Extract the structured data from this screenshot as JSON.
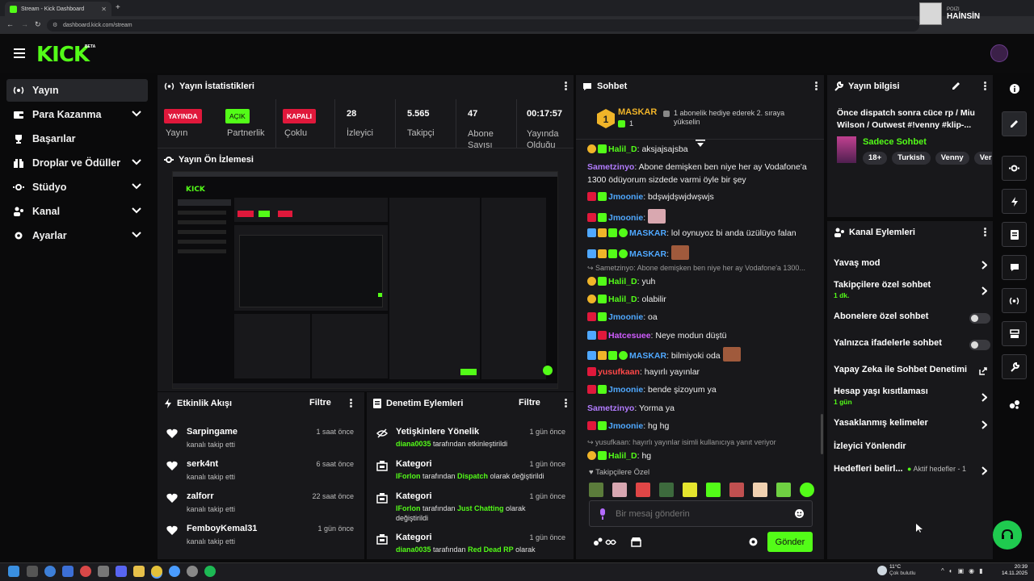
{
  "browser": {
    "tab_title": "Stream - Kick Dashboard",
    "url": "dashboard.kick.com/stream",
    "profile_label": "POIZI",
    "profile_name": "HAİNSİN"
  },
  "header": {
    "logo": "KICK",
    "beta": "BETA"
  },
  "sidebar": {
    "items": [
      {
        "label": "Yayın",
        "icon": "broadcast-icon",
        "active": true
      },
      {
        "label": "Para Kazanma",
        "icon": "wallet-icon",
        "chevron": true
      },
      {
        "label": "Başarılar",
        "icon": "trophy-icon"
      },
      {
        "label": "Droplar ve Ödüller",
        "icon": "gift-icon",
        "chevron": true
      },
      {
        "label": "Stüdyo",
        "icon": "studio-icon",
        "chevron": true
      },
      {
        "label": "Kanal",
        "icon": "users-icon",
        "chevron": true
      },
      {
        "label": "Ayarlar",
        "icon": "gear-icon",
        "chevron": true
      }
    ]
  },
  "stats_panel": {
    "title": "Yayın İstatistikleri",
    "items": [
      {
        "badge": "YAYINDA",
        "label": "Yayın",
        "color": "#e0183b"
      },
      {
        "badge": "AÇIK",
        "label": "Partnerlik",
        "color": "#53fc18"
      },
      {
        "badge": "KAPALI",
        "label": "Çoklu",
        "color": "#e0183b"
      },
      {
        "value": "28",
        "label": "İzleyici"
      },
      {
        "value": "5.565",
        "label": "Takipçi"
      },
      {
        "value": "47",
        "label": "Abone Sayısı"
      },
      {
        "value": "00:17:57",
        "label": "Yayında Olduğu"
      }
    ]
  },
  "preview_panel": {
    "title": "Yayın Ön İzlemesi"
  },
  "activity_panel": {
    "title": "Etkinlik Akışı",
    "filter": "Filtre",
    "items": [
      {
        "name": "Sarpingame",
        "sub": "kanalı takip etti",
        "time": "1 saat önce"
      },
      {
        "name": "serk4nt",
        "sub": "kanalı takip etti",
        "time": "6 saat önce"
      },
      {
        "name": "zalforr",
        "sub": "kanalı takip etti",
        "time": "22 saat önce"
      },
      {
        "name": "FemboyKemal31",
        "sub": "kanalı takip etti",
        "time": "1 gün önce"
      }
    ]
  },
  "mod_panel": {
    "title": "Denetim Eylemleri",
    "filter": "Filtre",
    "items": [
      {
        "name": "Yetişkinlere Yönelik",
        "user": "diana0035",
        "mid": " tarafından etkinleştirildi",
        "value": "",
        "tail": "",
        "time": "1 gün önce"
      },
      {
        "name": "Kategori",
        "user": "IForlon",
        "mid": " tarafından ",
        "value": "Dispatch",
        "tail": " olarak değiştirildi",
        "time": "1 gün önce"
      },
      {
        "name": "Kategori",
        "user": "IForlon",
        "mid": " tarafından ",
        "value": "Just Chatting",
        "tail": " olarak değiştirildi",
        "time": "1 gün önce"
      },
      {
        "name": "Kategori",
        "user": "diana0035",
        "mid": " tarafından ",
        "value": "Red Dead RP",
        "tail": " olarak",
        "time": "1 gün önce"
      }
    ]
  },
  "chat_panel": {
    "title": "Sohbet",
    "pinned_user": "MASKAR",
    "pinned_text": "1 abonelik hediye ederek 2. sıraya yükselin",
    "pinned_rank": "1",
    "messages": [
      {
        "user": "Halil_D",
        "color": "#53fc18",
        "text": ": aksjajsajsba",
        "badge": "gold"
      },
      {
        "user": "Sametzinyo",
        "color": "#b27cff",
        "text": ": Abone demişken ben niye her ay Vodafone'a 1300 ödüyorum sizdede varmi öyle bir şey"
      },
      {
        "user": "Jmoonie",
        "color": "#4fa8ff",
        "text": ": bdşwjdşwjdwşwjs",
        "badge": "red"
      },
      {
        "user": "Jmoonie",
        "color": "#4fa8ff",
        "text": ":",
        "badge": "red",
        "emote": "mouse"
      },
      {
        "user": "MASKAR",
        "color": "#4fa8ff",
        "text": ": lol oynuyoz bi anda üzülüyo falan",
        "badge": "multi"
      },
      {
        "user": "MASKAR",
        "color": "#4fa8ff",
        "text": ":",
        "badge": "multi",
        "emote": "face"
      },
      {
        "reply": "Sametzinyo: Abone demişken ben niye her ay Vodafone'a 1300..."
      },
      {
        "user": "Halil_D",
        "color": "#53fc18",
        "text": ": yuh",
        "badge": "gold"
      },
      {
        "user": "Halil_D",
        "color": "#53fc18",
        "text": ": olabilir",
        "badge": "gold"
      },
      {
        "user": "Jmoonie",
        "color": "#4fa8ff",
        "text": ": oa",
        "badge": "red"
      },
      {
        "user": "Hatcesuee",
        "color": "#d05cff",
        "text": ": Neye modun düştü",
        "badge": "blue"
      },
      {
        "user": "MASKAR",
        "color": "#4fa8ff",
        "text": ": bilmiyoki oda",
        "badge": "multi",
        "emote": "face"
      },
      {
        "user": "yusufkaan",
        "color": "#ff4848",
        "text": ": hayırlı yayınlar",
        "badge": "red"
      },
      {
        "user": "Jmoonie",
        "color": "#4fa8ff",
        "text": ": bende şizoyum ya",
        "badge": "red"
      },
      {
        "user": "Sametzinyo",
        "color": "#b27cff",
        "text": ": Yorma ya"
      },
      {
        "user": "Jmoonie",
        "color": "#4fa8ff",
        "text": ": hg hg",
        "badge": "red"
      },
      {
        "reply": "yusufkaan: hayırlı yayınlar isimli kullanıcıya yanıt veriyor"
      },
      {
        "user": "Halil_D",
        "color": "#53fc18",
        "text": ": hg",
        "badge": "gold"
      }
    ],
    "followers_only": "Takipçilere Özel",
    "input_placeholder": "Bir mesaj gönderin",
    "send_label": "Gönder"
  },
  "stream_info": {
    "title": "Yayın bilgisi",
    "stream_title": "Önce dispatch sonra cüce rp / Miu Wilson / Outwest #!venny #klip-...",
    "category": "Sadece Sohbet",
    "tags": [
      "18+",
      "Turkish",
      "Venny",
      "Ver"
    ]
  },
  "channel_actions": {
    "title": "Kanal Eylemleri",
    "items": [
      {
        "label": "Yavaş mod",
        "type": "arrow"
      },
      {
        "label": "Takipçilere özel sohbet",
        "sub": "1 dk.",
        "type": "arrow"
      },
      {
        "label": "Abonelere özel sohbet",
        "type": "toggle"
      },
      {
        "label": "Yalnızca ifadelerle sohbet",
        "type": "toggle"
      },
      {
        "label": "Yapay Zeka ile Sohbet Denetimi",
        "type": "external"
      },
      {
        "label": "Hesap yaşı kısıtlaması",
        "sub": "1 gün",
        "type": "arrow"
      },
      {
        "label": "Yasaklanmış kelimeler",
        "type": "arrow"
      },
      {
        "label": "İzleyici Yönlendir",
        "type": "none"
      },
      {
        "label": "Hedefleri belirl...",
        "extra": "Aktif hedefler - 1",
        "type": "arrow"
      }
    ]
  },
  "taskbar": {
    "weather_temp": "11°C",
    "weather_desc": "Çok bulutlu",
    "time": "20:39",
    "date": "14.11.2025"
  }
}
